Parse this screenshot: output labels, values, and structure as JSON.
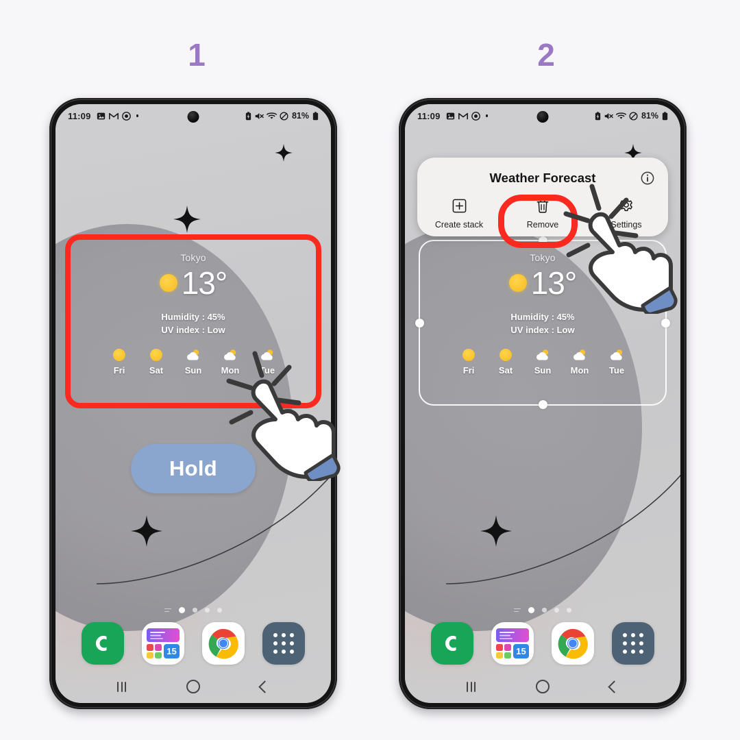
{
  "page": {
    "background_color": "#f7f6f9",
    "accent_color": "#9b78c4",
    "highlight_color": "#fb2a21"
  },
  "steps": [
    {
      "number": "1"
    },
    {
      "number": "2"
    }
  ],
  "status_bar": {
    "time": "11:09",
    "battery_percent": "81%",
    "left_icons": [
      "gallery-icon",
      "gmail-icon",
      "target-icon",
      "dot-icon"
    ],
    "right_icons": [
      "battery-saver-icon",
      "mute-icon",
      "wifi-icon",
      "do-not-disturb-icon",
      "battery-icon"
    ]
  },
  "widget": {
    "city": "Tokyo",
    "temperature": "13°",
    "humidity": "Humidity : 45%",
    "uv_index": "UV index : Low",
    "forecast": [
      {
        "day": "Fri",
        "icon": "sun-icon"
      },
      {
        "day": "Sat",
        "icon": "sun-icon"
      },
      {
        "day": "Sun",
        "icon": "partly-cloudy-icon"
      },
      {
        "day": "Mon",
        "icon": "partly-cloudy-icon"
      },
      {
        "day": "Tue",
        "icon": "partly-cloudy-icon"
      }
    ]
  },
  "hold_button": {
    "label": "Hold",
    "color": "#8aa5ce"
  },
  "popup": {
    "title": "Weather Forecast",
    "info_icon": "info-icon",
    "actions": [
      {
        "label": "Create stack",
        "icon": "plus-square-icon"
      },
      {
        "label": "Remove",
        "icon": "trash-icon"
      },
      {
        "label": "Settings",
        "icon": "gear-icon"
      }
    ]
  },
  "dock": {
    "items": [
      {
        "name": "phone-app-icon",
        "label": "Phone"
      },
      {
        "name": "gallery-app-icon",
        "label": "Gallery",
        "badge": "15"
      },
      {
        "name": "chrome-app-icon",
        "label": "Chrome"
      },
      {
        "name": "app-drawer-icon",
        "label": "Apps"
      }
    ]
  },
  "nav_bar": {
    "recents": "recents-icon",
    "home": "home-icon",
    "back": "back-icon"
  },
  "page_indicator": {
    "total": 5,
    "active_index": 1
  }
}
